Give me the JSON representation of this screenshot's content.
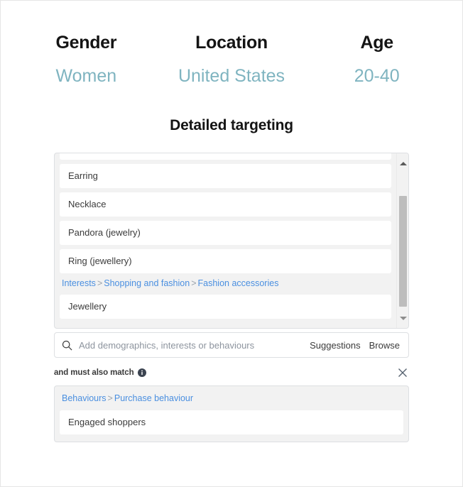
{
  "summary": [
    {
      "label": "Gender",
      "value": "Women"
    },
    {
      "label": "Location",
      "value": "United States"
    },
    {
      "label": "Age",
      "value": "20-40"
    }
  ],
  "section": {
    "title": "Detailed targeting"
  },
  "targeting": {
    "options": [
      {
        "text": "Earring"
      },
      {
        "text": "Necklace"
      },
      {
        "text": "Pandora (jewelry)"
      },
      {
        "text": "Ring (jewellery)"
      }
    ],
    "breadcrumb": {
      "part1": "Interests",
      "sep1": ">",
      "part2": "Shopping and fashion",
      "sep2": ">",
      "part3": "Fashion accessories"
    },
    "option_after_breadcrumb": {
      "text": "Jewellery"
    },
    "scrollbar": {
      "up": "▲",
      "down": "▼"
    }
  },
  "search": {
    "placeholder": "Add demographics, interests or behaviours",
    "value": "",
    "suggestions_label": "Suggestions",
    "browse_label": "Browse",
    "icon": "search-icon"
  },
  "must_match": {
    "label": "and must also match",
    "info_icon": "info-icon",
    "close_icon": "close-icon",
    "breadcrumb": {
      "part1": "Behaviours",
      "sep1": ">",
      "part2": "Purchase behaviour"
    },
    "option": {
      "text": "Engaged shoppers"
    }
  },
  "colors": {
    "accent_teal": "#7fb4c0",
    "link_blue": "#4a8fe0",
    "text_dark": "#141414",
    "text_body": "#3b3b3b",
    "panel_bg": "#f2f2f2",
    "border": "#dddfe2"
  }
}
